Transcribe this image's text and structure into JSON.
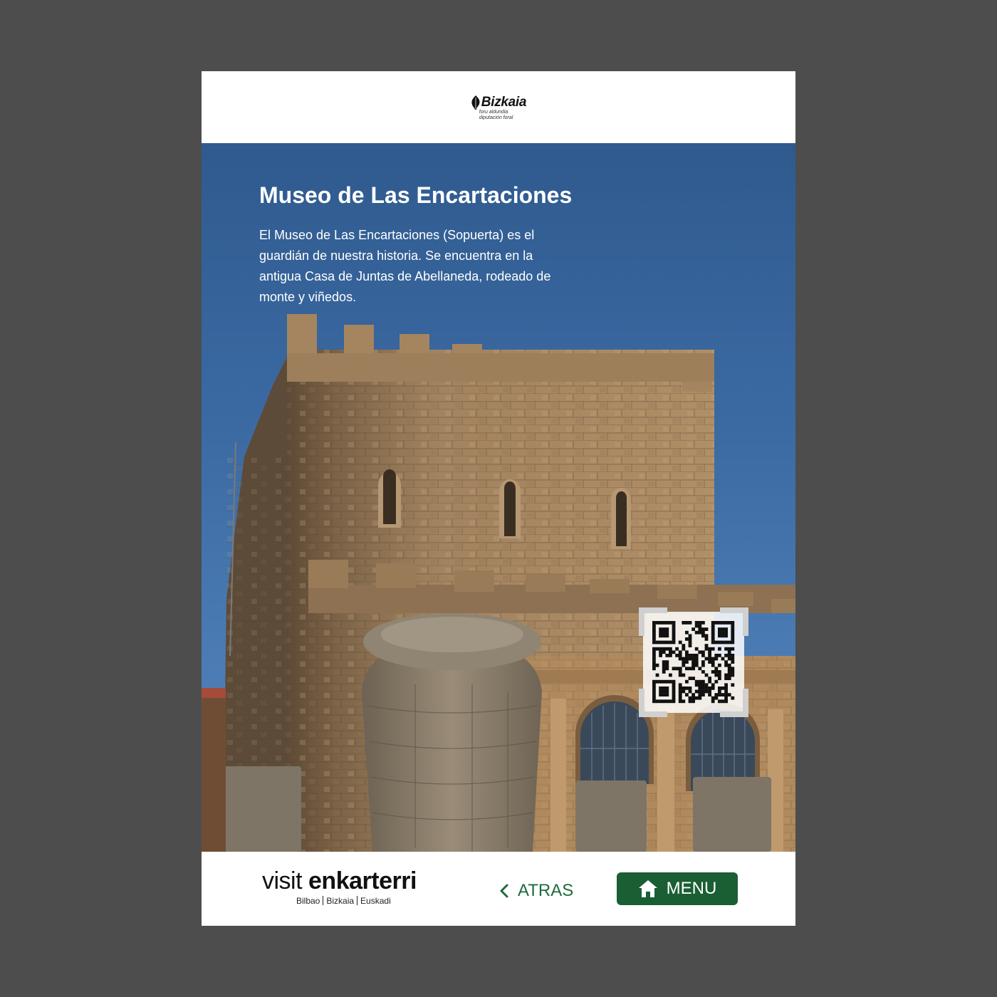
{
  "header": {
    "logo_name": "Bizkaia",
    "logo_sub_1": "foru aldundia",
    "logo_sub_2": "diputación foral"
  },
  "hero": {
    "title": "Museo de Las Encartaciones",
    "description": "El Museo de Las Encartaciones (Sopuerta) es el guardián de nuestra historia. Se encuentra en la antigua Casa de Juntas de Abellaneda, rodeado de monte y viñedos."
  },
  "footer": {
    "brand_light": "visit",
    "brand_bold": "enkarterri",
    "brand_places": [
      "Bilbao",
      "Bizkaia",
      "Euskadi"
    ],
    "back_label": "ATRAS",
    "menu_label": "MENU"
  },
  "colors": {
    "page_background": "#4d4d4d",
    "sky": "#3b6aa3",
    "accent_green": "#1a5e34",
    "back_text_green": "#1f6b3d"
  },
  "icons": [
    "leaf-icon",
    "qr-code-icon",
    "chevron-left-icon",
    "home-icon"
  ]
}
